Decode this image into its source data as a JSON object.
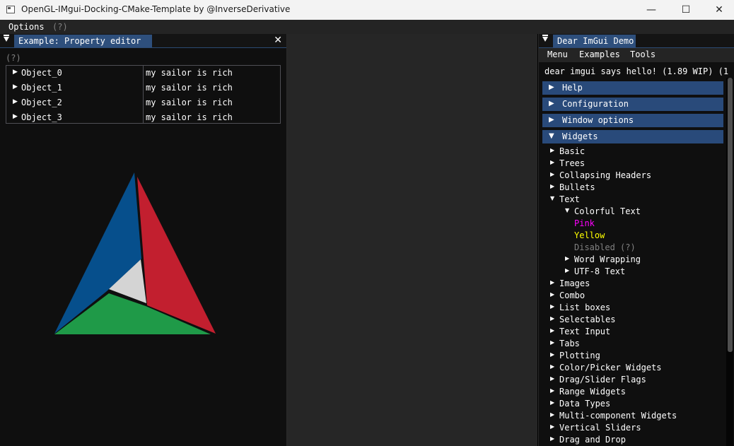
{
  "window": {
    "title": "OpenGL-IMgui-Docking-CMake-Template by @InverseDerivative",
    "minimize_glyph": "—",
    "maximize_glyph": "☐",
    "close_glyph": "✕"
  },
  "menubar": {
    "options_label": "Options",
    "help_label": "(?)"
  },
  "property_editor": {
    "tab_label": "Example: Property editor",
    "close_glyph": "✕",
    "help_label": "(?)",
    "rows": [
      {
        "name": "Object_0",
        "value": "my sailor is rich"
      },
      {
        "name": "Object_1",
        "value": "my sailor is rich"
      },
      {
        "name": "Object_2",
        "value": "my sailor is rich"
      },
      {
        "name": "Object_3",
        "value": "my sailor is rich"
      }
    ],
    "logo_colors": {
      "blue": "#064f8c",
      "red": "#c21f2f",
      "green": "#1f9a48",
      "grey": "#d4d4d4"
    }
  },
  "demo": {
    "tab_label": "Dear ImGui Demo",
    "menu": {
      "menu": "Menu",
      "examples": "Examples",
      "tools": "Tools"
    },
    "hello_text": "dear imgui says hello! (1.89 WIP) (1",
    "headers": [
      {
        "label": "Help",
        "open": false
      },
      {
        "label": "Configuration",
        "open": false
      },
      {
        "label": "Window options",
        "open": false
      },
      {
        "label": "Widgets",
        "open": true
      }
    ],
    "tree": {
      "basic": "Basic",
      "trees": "Trees",
      "collapsing": "Collapsing Headers",
      "bullets": "Bullets",
      "text": "Text",
      "colorful": "Colorful Text",
      "pink": "Pink",
      "yellow": "Yellow",
      "disabled": "Disabled (?)",
      "word_wrapping": "Word Wrapping",
      "utf8": "UTF-8 Text",
      "items": [
        "Images",
        "Combo",
        "List boxes",
        "Selectables",
        "Text Input",
        "Tabs",
        "Plotting",
        "Color/Picker Widgets",
        "Drag/Slider Flags",
        "Range Widgets",
        "Data Types",
        "Multi-component Widgets",
        "Vertical Sliders",
        "Drag and Drop"
      ]
    },
    "colors": {
      "pink": "#ff00ff",
      "yellow": "#ffff00",
      "disabled": "#808080",
      "header": "#294a7a"
    }
  }
}
